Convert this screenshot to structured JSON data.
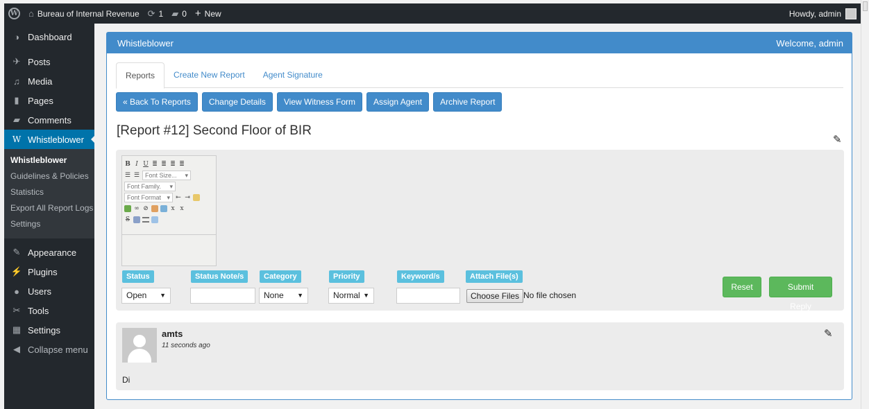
{
  "adminbar": {
    "wp_logo": "wordpress-logo",
    "site_name": "Bureau of Internal Revenue",
    "updates_count": "1",
    "comments_count": "0",
    "new_label": "New",
    "howdy": "Howdy, admin"
  },
  "sidebar": {
    "items_top": [
      {
        "label": "Dashboard",
        "icon": "dashboard-icon"
      },
      {
        "label": "Posts",
        "icon": "pin-icon"
      },
      {
        "label": "Media",
        "icon": "media-icon"
      },
      {
        "label": "Pages",
        "icon": "pages-icon"
      },
      {
        "label": "Comments",
        "icon": "comments-icon"
      },
      {
        "label": "Whistleblower",
        "icon": "whistleblower-icon"
      }
    ],
    "submenu": [
      "Whistleblower",
      "Guidelines & Policies",
      "Statistics",
      "Export All Report Logs",
      "Settings"
    ],
    "items_bottom": [
      {
        "label": "Appearance",
        "icon": "brush-icon"
      },
      {
        "label": "Plugins",
        "icon": "plug-icon"
      },
      {
        "label": "Users",
        "icon": "users-icon"
      },
      {
        "label": "Tools",
        "icon": "wrench-icon"
      },
      {
        "label": "Settings",
        "icon": "settings-icon"
      },
      {
        "label": "Collapse menu",
        "icon": "collapse-icon"
      }
    ]
  },
  "panel": {
    "title": "Whistleblower",
    "welcome": "Welcome, admin",
    "tabs": [
      "Reports",
      "Create New Report",
      "Agent Signature"
    ],
    "buttons": [
      "« Back To Reports",
      "Change Details",
      "View Witness Form",
      "Assign Agent",
      "Archive Report"
    ],
    "report_title": "[Report #12] Second Floor of BIR"
  },
  "editor": {
    "font_size": "Font Size...",
    "font_family": "Font Family.",
    "font_format": "Font Format"
  },
  "form": {
    "labels": {
      "status": "Status",
      "status_note": "Status Note/s",
      "category": "Category",
      "priority": "Priority",
      "keywords": "Keyword/s",
      "attach": "Attach File(s)"
    },
    "status_value": "Open",
    "category_value": "None",
    "priority_value": "Normal",
    "choose_files": "Choose Files",
    "file_status": "No file chosen",
    "reset": "Reset",
    "submit": "Submit Reply"
  },
  "comment": {
    "author": "amts",
    "time": "11 seconds ago",
    "body": "Di"
  },
  "colors": {
    "primary": "#428bca",
    "info": "#5bc0de",
    "success": "#5cb85c",
    "admin_dark": "#23282d",
    "admin_active": "#0073aa"
  }
}
